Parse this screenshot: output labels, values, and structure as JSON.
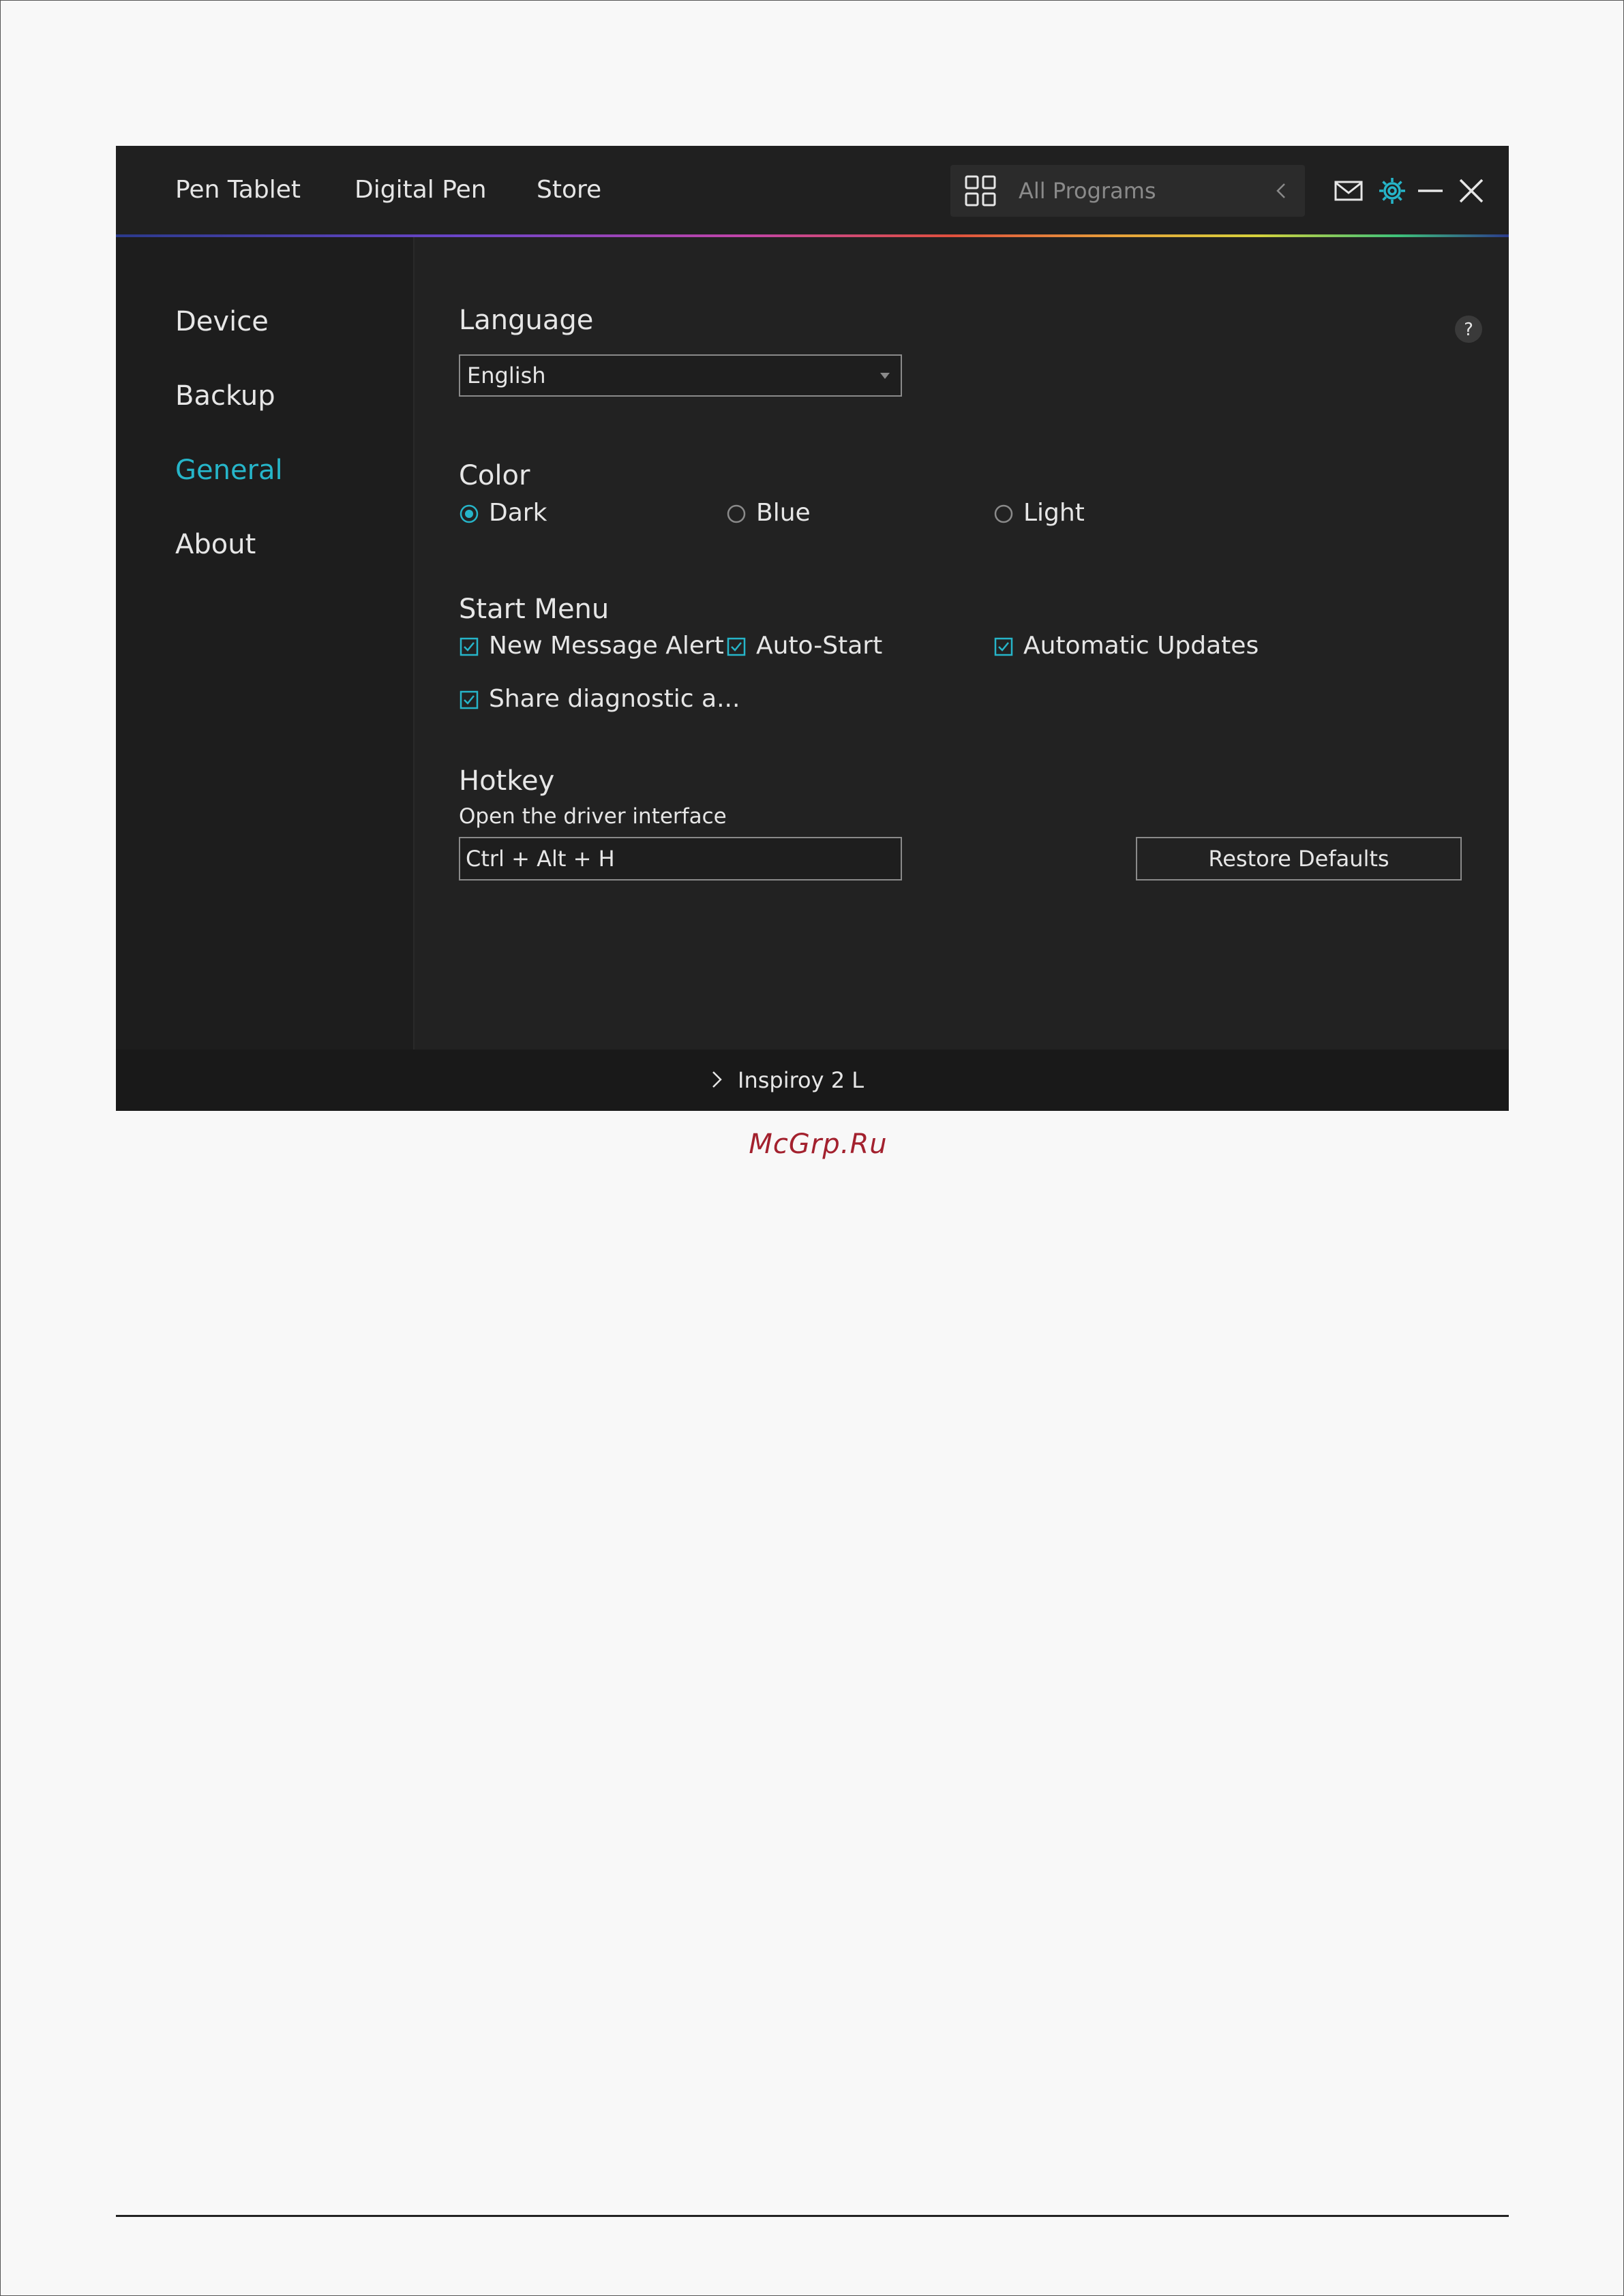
{
  "header": {
    "tabs": [
      {
        "label": "Pen Tablet"
      },
      {
        "label": "Digital Pen"
      },
      {
        "label": "Store"
      }
    ],
    "program_selector": {
      "label": "All Programs"
    },
    "icons": [
      "mail-icon",
      "gear-icon",
      "minimize-icon",
      "close-icon"
    ],
    "accent_color": "#26b5c9"
  },
  "sidebar": {
    "items": [
      {
        "label": "Device",
        "active": false
      },
      {
        "label": "Backup",
        "active": false
      },
      {
        "label": "General",
        "active": true
      },
      {
        "label": "About",
        "active": false
      }
    ]
  },
  "general": {
    "language": {
      "title": "Language",
      "selected": "English"
    },
    "color": {
      "title": "Color",
      "options": [
        {
          "label": "Dark",
          "selected": true
        },
        {
          "label": "Blue",
          "selected": false
        },
        {
          "label": "Light",
          "selected": false
        }
      ]
    },
    "start_menu": {
      "title": "Start Menu",
      "options": [
        {
          "label": "New Message Alert",
          "checked": true
        },
        {
          "label": "Auto-Start",
          "checked": true
        },
        {
          "label": "Automatic Updates",
          "checked": true
        },
        {
          "label": "Share diagnostic a...",
          "checked": true
        }
      ]
    },
    "hotkey": {
      "title": "Hotkey",
      "description": "Open the driver interface",
      "value": "Ctrl + Alt + H",
      "restore_label": "Restore Defaults"
    }
  },
  "footer": {
    "device_label": "Inspiroy 2 L"
  },
  "watermark": "McGrp.Ru"
}
